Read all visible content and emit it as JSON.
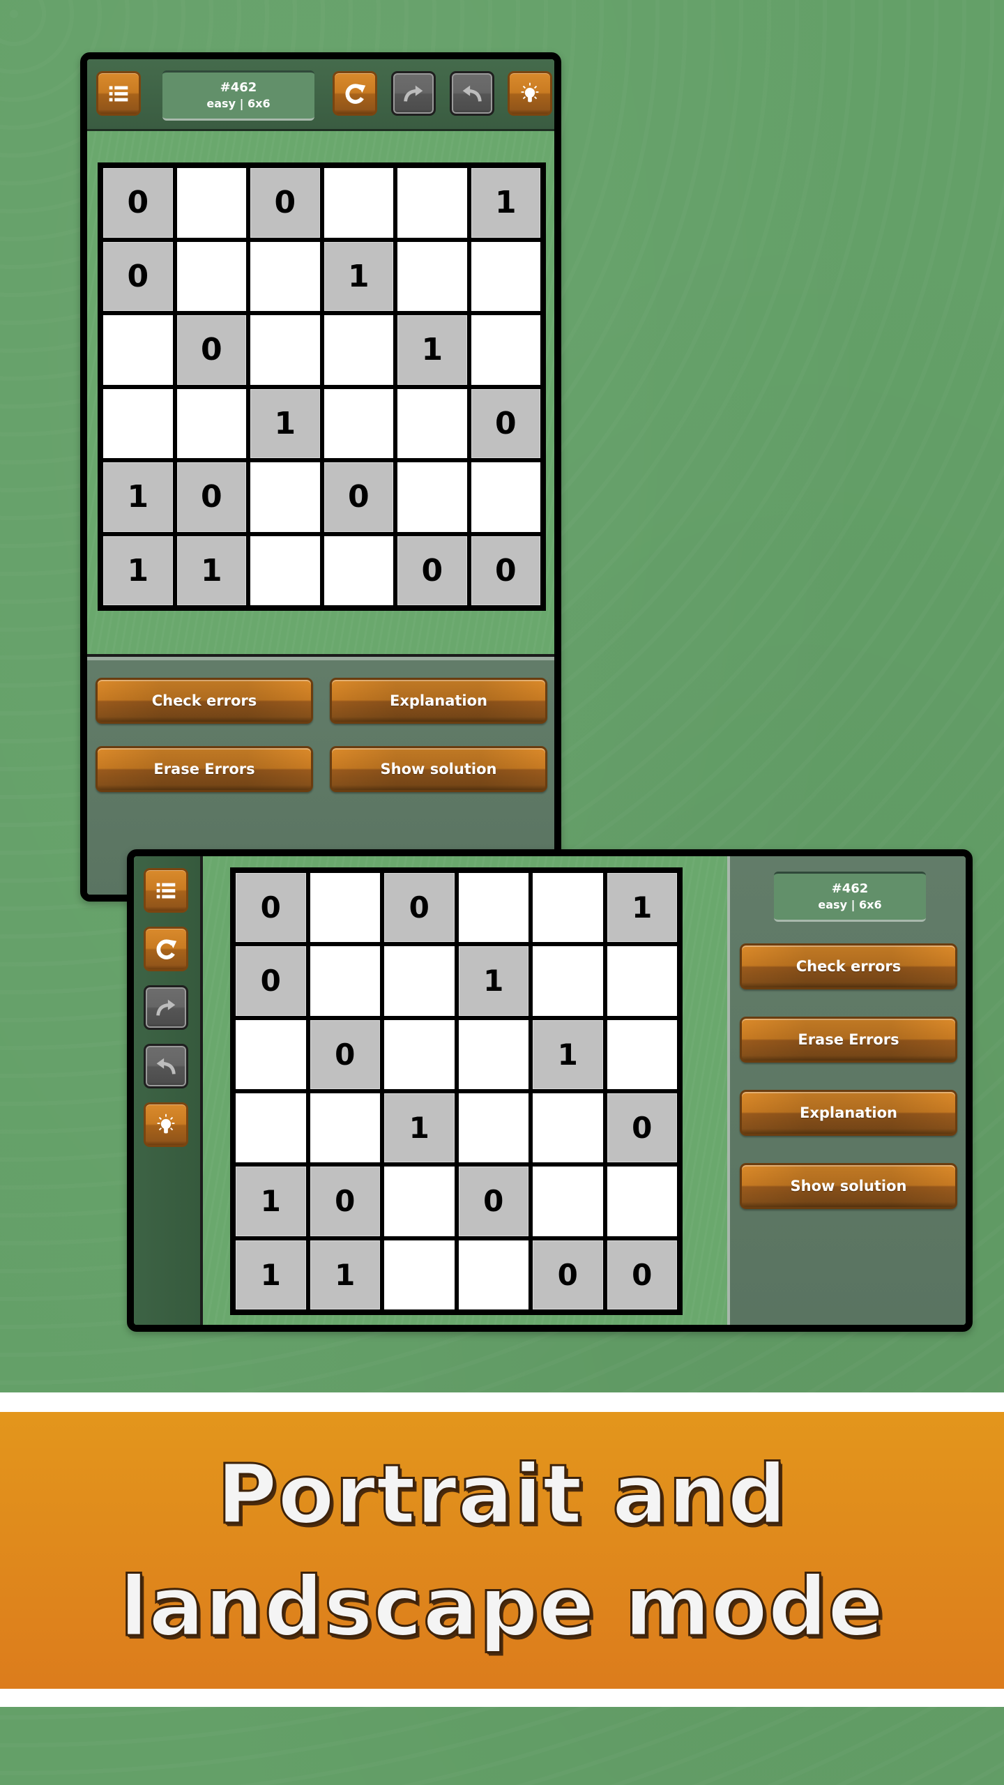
{
  "theme": {
    "background_green": "#64a068",
    "accent_orange": "#d98a2c",
    "banner_orange": "#e3961c",
    "given_cell_gray": "#c0c0c0"
  },
  "puzzle": {
    "number": "#462",
    "meta": "easy | 6x6",
    "grid": [
      [
        "0",
        "",
        "0",
        "",
        "",
        "1"
      ],
      [
        "0",
        "",
        "",
        "1",
        "",
        ""
      ],
      [
        "",
        "0",
        "",
        "",
        "1",
        ""
      ],
      [
        "",
        "",
        "1",
        "",
        "",
        "0"
      ],
      [
        "1",
        "0",
        "",
        "0",
        "",
        ""
      ],
      [
        "1",
        "1",
        "",
        "",
        "0",
        "0"
      ]
    ]
  },
  "toolbar": {
    "icons": [
      "list-icon",
      "restart-icon",
      "redo-icon",
      "undo-icon",
      "hint-icon"
    ]
  },
  "actions": {
    "check_errors": "Check errors",
    "explanation": "Explanation",
    "erase_errors": "Erase Errors",
    "show_solution": "Show solution"
  },
  "banner": {
    "line1": "Portrait and",
    "line2": "landscape mode"
  }
}
